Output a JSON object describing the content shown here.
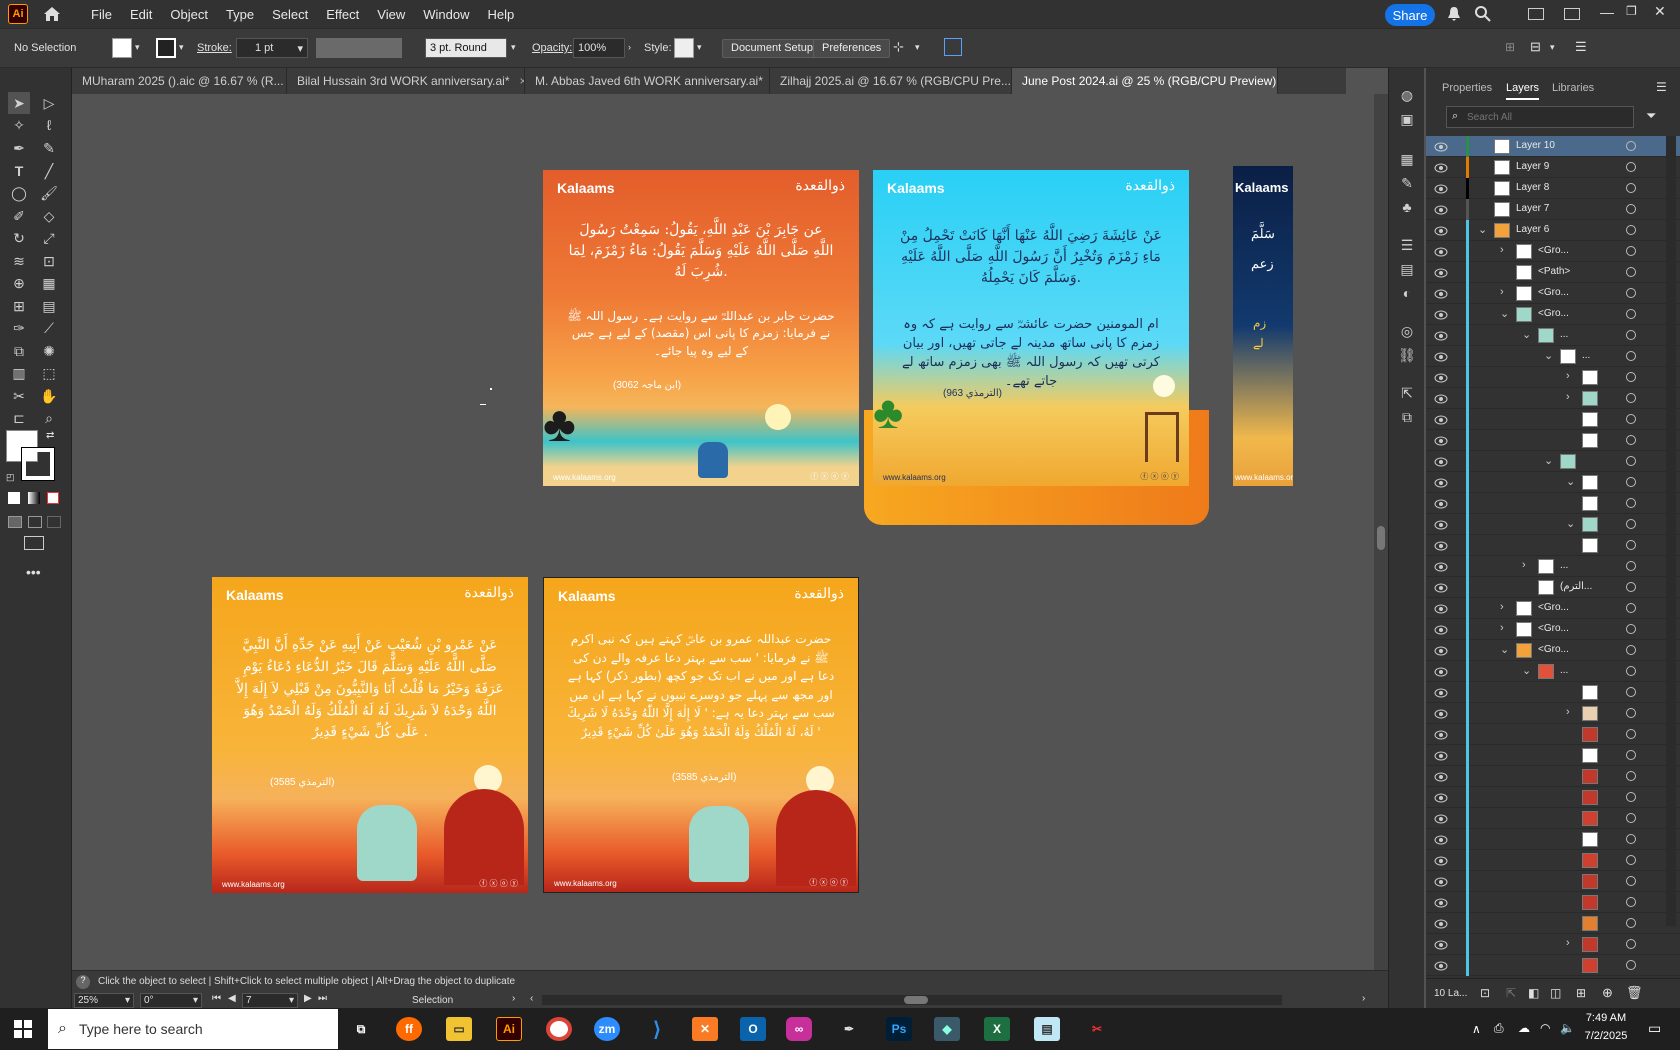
{
  "menubar": {
    "app": "Ai",
    "items": [
      "File",
      "Edit",
      "Object",
      "Type",
      "Select",
      "Effect",
      "View",
      "Window",
      "Help"
    ],
    "share": "Share"
  },
  "control": {
    "selection": "No Selection",
    "stroke_label": "Stroke:",
    "stroke_value": "1 pt",
    "brush": "3 pt. Round",
    "opacity_label": "Opacity:",
    "opacity_value": "100%",
    "style_label": "Style:",
    "document_setup": "Document Setup",
    "preferences": "Preferences"
  },
  "tabs": [
    {
      "label": "MUharam 2025 ().aic @ 16.67 % (R..."
    },
    {
      "label": "Bilal Hussain  3rd  WORK anniversary.ai*"
    },
    {
      "label": "M. Abbas Javed  6th  WORK anniversary.ai*"
    },
    {
      "label": "Zilhajj 2025.ai @ 16.67 % (RGB/CPU Pre..."
    },
    {
      "label": "June Post 2024.ai @ 25 % (RGB/CPU Preview)"
    }
  ],
  "artboards": {
    "brand": "Kalaams",
    "month_logo": "ذوالقعدة",
    "website": "www.kalaams.org",
    "social": "ⓕ ⓧ ⓞ ⓨ",
    "a1": {
      "arabic": "عن جَابِرَ بْنَ عَبْدِ اللَّهِ، يَقُولُ: سَمِعْتُ رَسُولَ اللَّهِ صَلَّى اللَّهُ عَلَيْهِ وَسَلَّمَ يَقُولُ: مَاءُ زَمْزَمَ، لِمَا شُرِبَ لَهُ.",
      "urdu": "حضرت جابر بن عبداللہؓ سے روایت ہے۔ رسول اللہ ﷺ نے فرمایا: زمزم کا پانی اس (مقصد) کے لیے ہے جس کے لیے وہ پیا جائے۔",
      "ref": "(ابن ماجہ 3062)"
    },
    "a2": {
      "arabic": "عَنْ عَائِشَةَ رَضِيَ اللَّهُ عَنْهَا أَنَّهَا كَانَتْ تَحْمِلُ مِنْ مَاءِ زَمْزَمَ وَتُخْبِرُ أَنَّ رَسُولَ اللَّهِ صَلَّى اللَّهُ عَلَيْهِ وَسَلَّمَ كَانَ يَحْمِلُهُ.",
      "urdu": "ام المومنین حضرت عائشہؓ سے روایت ہے کہ وہ زمزم کا پانی ساتھ مدینہ لے جاتی تھیں، اور بیان کرتی تھیں کہ رسول اللہ ﷺ بھی زمزم ساتھ لے جاتے تھے۔",
      "ref": "(الترمذي 963)"
    },
    "a3": {
      "arabic": "عَنْ عَمْرِو بْنِ شُعَيْبٍ عَنْ أَبِيهِ عَنْ جَدِّهِ أَنَّ النَّبِيَّ صَلَّى اللَّهُ عَلَيْهِ وَسَلَّمَ قَالَ خَيْرُ الدُّعَاءِ دُعَاءُ يَوْمِ عَرَفَةَ وَخَيْرُ مَا قُلْتُ أَنَا وَالنَّبِيُّونَ مِنْ قَبْلِي لاَ إِلَهَ إِلاَّ اللَّهُ وَحْدَهُ لاَ شَرِيكَ لَهُ لَهُ الْمُلْكُ وَلَهُ الْحَمْدُ وَهُوَ عَلَى كُلِّ شَيْءٍ قَدِيرٌ .",
      "ref": "(الترمذي 3585)"
    },
    "a4": {
      "urdu": "حضرت عبداللہ عمرو بن عاصؓ کہتے ہیں کہ نبی اکرم ﷺ نے فرمایا: ' سب سے بہتر دعا عرفہ والے دن کی دعا ہے اور میں نے اب تک جو کچھ (بطور ذکر) کہا ہے اور مجھ سے پہلے جو دوسرے نبیوں نے کہا ہے ان میں سب سے بہتر دعا یہ ہے: ' لَا إِلٰهَ إِلَّا اللّٰهُ وَحْدَهُ لَا شَرِيكَ لَهُ، لَهُ الْمُلْكُ وَلَهُ الْحَمْدُ وَهُوَ عَلَىٰ كُلِّ شَيْءٍ قَدِيرٌ '",
      "ref": "(الترمذي 3585)"
    },
    "a5": {
      "arabic_a": "سَلَّمَ",
      "arabic_b": "زعم",
      "arabic_c": "زم",
      "arabic_d": "لے"
    }
  },
  "panel": {
    "tabs": [
      "Properties",
      "Layers",
      "Libraries"
    ],
    "search_placeholder": "Search All",
    "footer": "10 La...",
    "layers": [
      {
        "name": "Layer 10",
        "indent": 0,
        "chev": "",
        "thumb": "#ffffff",
        "bar": "#2a8f4a",
        "sel": true
      },
      {
        "name": "Layer 9",
        "indent": 0,
        "chev": "",
        "thumb": "#ffffff",
        "bar": "#e07b00"
      },
      {
        "name": "Layer 8",
        "indent": 0,
        "chev": "",
        "thumb": "#ffffff",
        "bar": "#000000"
      },
      {
        "name": "Layer 7",
        "indent": 0,
        "chev": "",
        "thumb": "#ffffff",
        "bar": "#555555"
      },
      {
        "name": "Layer 6",
        "indent": 0,
        "chev": "⌄",
        "thumb": "#f2a13b",
        "bar": "#4fc5e6"
      },
      {
        "name": "<Gro...",
        "indent": 1,
        "chev": "›",
        "thumb": "#ffffff",
        "bar": "#4fc5e6"
      },
      {
        "name": "<Path>",
        "indent": 1,
        "chev": "",
        "thumb": "#ffffff",
        "bar": "#4fc5e6"
      },
      {
        "name": "<Gro...",
        "indent": 1,
        "chev": "›",
        "thumb": "#ffffff",
        "bar": "#4fc5e6"
      },
      {
        "name": "<Gro...",
        "indent": 1,
        "chev": "⌄",
        "thumb": "#9fd7c9",
        "bar": "#4fc5e6"
      },
      {
        "name": "...",
        "indent": 2,
        "chev": "⌄",
        "thumb": "#9fd7c9",
        "bar": "#4fc5e6"
      },
      {
        "name": "...",
        "indent": 3,
        "chev": "⌄",
        "thumb": "#ffffff",
        "bar": "#4fc5e6"
      },
      {
        "name": "",
        "indent": 4,
        "chev": "›",
        "thumb": "#ffffff",
        "bar": "#4fc5e6"
      },
      {
        "name": "",
        "indent": 4,
        "chev": "›",
        "thumb": "#9fd7c9",
        "bar": "#4fc5e6"
      },
      {
        "name": "",
        "indent": 4,
        "chev": "",
        "thumb": "#ffffff",
        "bar": "#4fc5e6"
      },
      {
        "name": "",
        "indent": 4,
        "chev": "",
        "thumb": "#ffffff",
        "bar": "#4fc5e6"
      },
      {
        "name": "",
        "indent": 3,
        "chev": "⌄",
        "thumb": "#9fd7c9",
        "bar": "#4fc5e6"
      },
      {
        "name": "",
        "indent": 4,
        "chev": "⌄",
        "thumb": "#ffffff",
        "bar": "#4fc5e6"
      },
      {
        "name": "",
        "indent": 4,
        "chev": "",
        "thumb": "#ffffff",
        "bar": "#4fc5e6"
      },
      {
        "name": "",
        "indent": 4,
        "chev": "⌄",
        "thumb": "#9fd7c9",
        "bar": "#4fc5e6"
      },
      {
        "name": "",
        "indent": 4,
        "chev": "",
        "thumb": "#ffffff",
        "bar": "#4fc5e6"
      },
      {
        "name": "...",
        "indent": 2,
        "chev": "›",
        "thumb": "#ffffff",
        "bar": "#4fc5e6"
      },
      {
        "name": "(الترم...",
        "indent": 2,
        "chev": "",
        "thumb": "#ffffff",
        "bar": "#4fc5e6"
      },
      {
        "name": "<Gro...",
        "indent": 1,
        "chev": "›",
        "thumb": "#ffffff",
        "bar": "#4fc5e6"
      },
      {
        "name": "<Gro...",
        "indent": 1,
        "chev": "›",
        "thumb": "#ffffff",
        "bar": "#4fc5e6"
      },
      {
        "name": "<Gro...",
        "indent": 1,
        "chev": "⌄",
        "thumb": "#f2a13b",
        "bar": "#4fc5e6"
      },
      {
        "name": "...",
        "indent": 2,
        "chev": "⌄",
        "thumb": "#e0523a",
        "bar": "#4fc5e6"
      },
      {
        "name": "",
        "indent": 4,
        "chev": "",
        "thumb": "#ffffff",
        "bar": "#4fc5e6"
      },
      {
        "name": "",
        "indent": 4,
        "chev": "›",
        "thumb": "#e8d0b0",
        "bar": "#4fc5e6"
      },
      {
        "name": "",
        "indent": 4,
        "chev": "",
        "thumb": "#c0392b",
        "bar": "#4fc5e6"
      },
      {
        "name": "",
        "indent": 4,
        "chev": "",
        "thumb": "#ffffff",
        "bar": "#4fc5e6"
      },
      {
        "name": "",
        "indent": 4,
        "chev": "",
        "thumb": "#c0392b",
        "bar": "#4fc5e6"
      },
      {
        "name": "",
        "indent": 4,
        "chev": "",
        "thumb": "#c0392b",
        "bar": "#4fc5e6"
      },
      {
        "name": "",
        "indent": 4,
        "chev": "",
        "thumb": "#d04030",
        "bar": "#4fc5e6"
      },
      {
        "name": "",
        "indent": 4,
        "chev": "",
        "thumb": "#ffffff",
        "bar": "#4fc5e6"
      },
      {
        "name": "",
        "indent": 4,
        "chev": "",
        "thumb": "#d04030",
        "bar": "#4fc5e6"
      },
      {
        "name": "",
        "indent": 4,
        "chev": "",
        "thumb": "#c0392b",
        "bar": "#4fc5e6"
      },
      {
        "name": "",
        "indent": 4,
        "chev": "",
        "thumb": "#c0392b",
        "bar": "#4fc5e6"
      },
      {
        "name": "",
        "indent": 4,
        "chev": "",
        "thumb": "#e08030",
        "bar": "#4fc5e6"
      },
      {
        "name": "",
        "indent": 4,
        "chev": "›",
        "thumb": "#c0392b",
        "bar": "#4fc5e6"
      },
      {
        "name": "",
        "indent": 4,
        "chev": "",
        "thumb": "#d04030",
        "bar": "#4fc5e6"
      }
    ]
  },
  "status": {
    "hint": "Click the object to select  |  Shift+Click to select multiple object  |  Alt+Drag the object to duplicate",
    "zoom": "25%",
    "rotate": "0°",
    "page": "7",
    "tool": "Selection"
  },
  "taskbar": {
    "search": "Type here to search",
    "time": "7:49 AM",
    "date": "7/2/2025"
  },
  "colors": {
    "accent": "#1473e6",
    "selected_layer": "#4b6a8b"
  }
}
